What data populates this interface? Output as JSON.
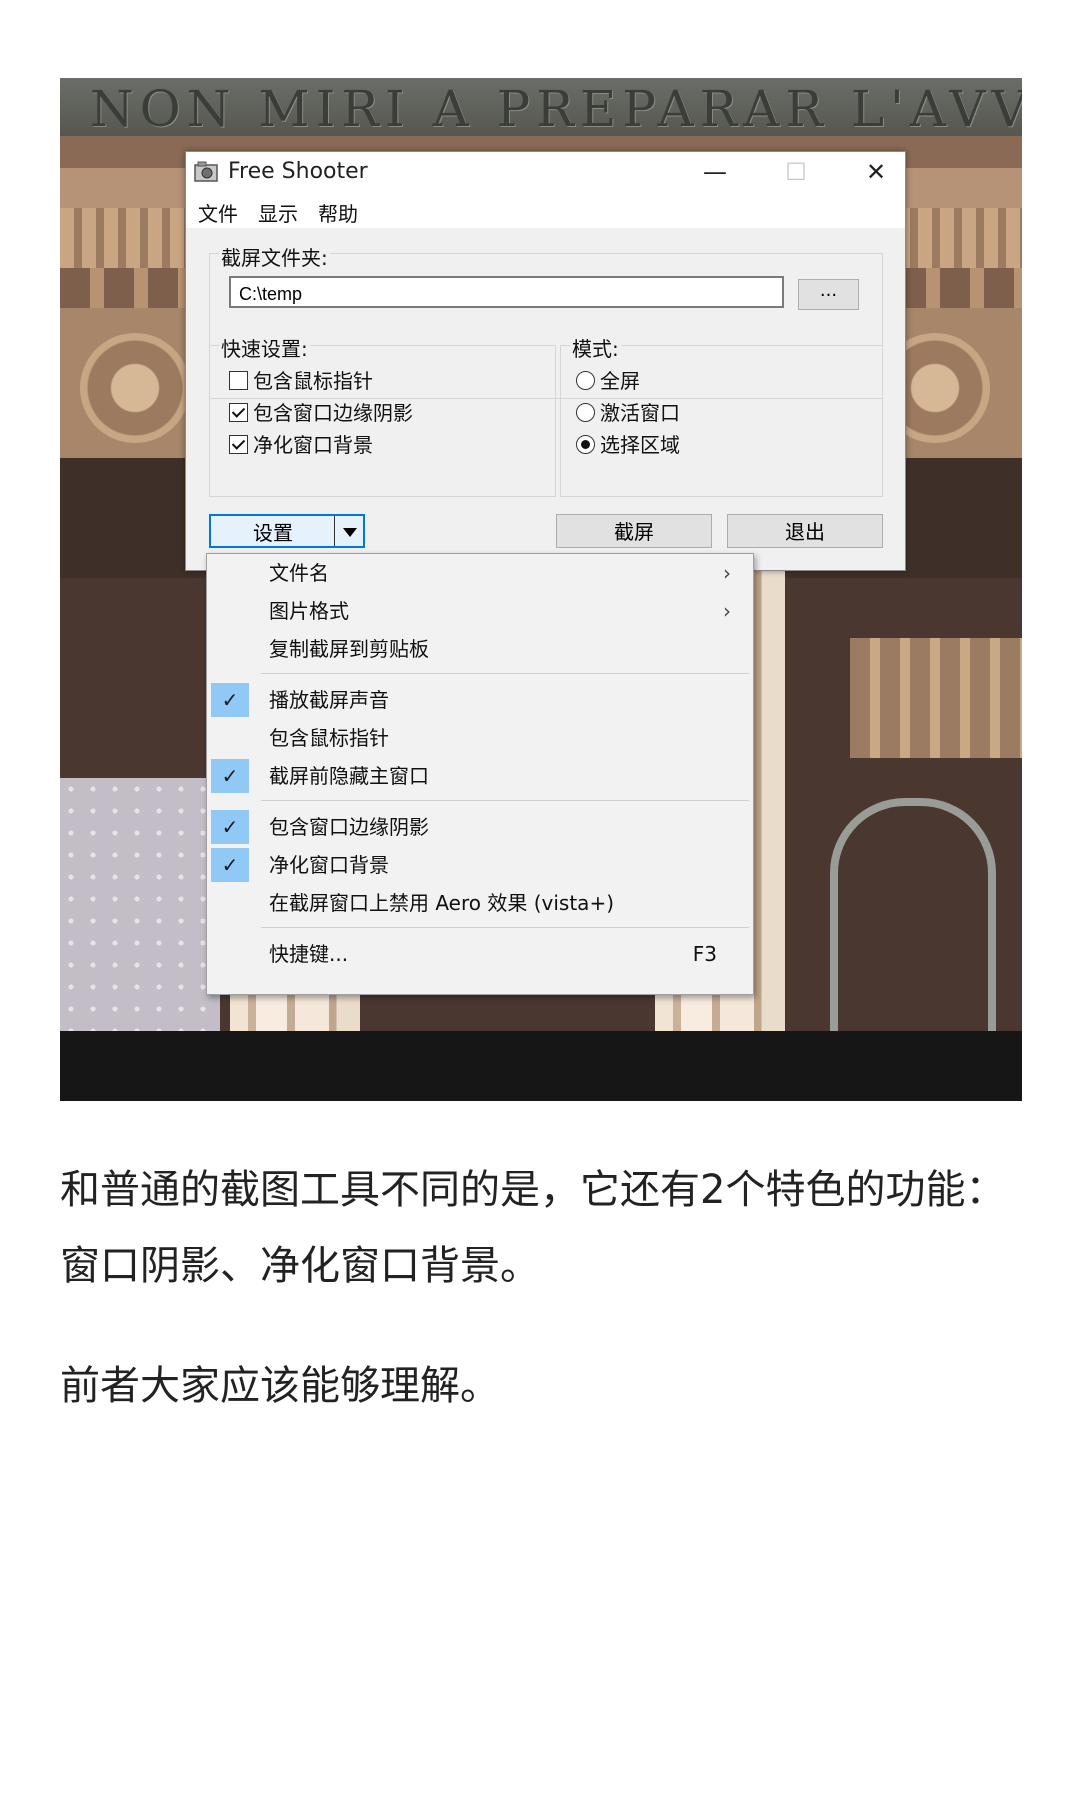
{
  "background_inscription": "NON MIRI A PREPARAR L'AVVEN",
  "window": {
    "title": "Free Shooter",
    "minimize": "—",
    "maximize": "☐",
    "close": "✕",
    "menu": [
      "文件",
      "显示",
      "帮助"
    ]
  },
  "folder_group": {
    "label": "截屏文件夹:",
    "path_value": "C:\\temp",
    "browse_label": "..."
  },
  "quick_settings": {
    "label": "快速设置:",
    "options": [
      {
        "label": "包含鼠标指针",
        "checked": false
      },
      {
        "label": "包含窗口边缘阴影",
        "checked": true
      },
      {
        "label": "净化窗口背景",
        "checked": true
      }
    ]
  },
  "mode": {
    "label": "模式:",
    "options": [
      {
        "label": "全屏",
        "selected": false
      },
      {
        "label": "激活窗口",
        "selected": false
      },
      {
        "label": "选择区域",
        "selected": true
      }
    ]
  },
  "buttons": {
    "settings": "设置",
    "capture": "截屏",
    "exit": "退出"
  },
  "dropdown": {
    "items": [
      {
        "label": "文件名",
        "checked": false,
        "submenu": true
      },
      {
        "label": "图片格式",
        "checked": false,
        "submenu": true
      },
      {
        "label": "复制截屏到剪贴板",
        "checked": false
      },
      {
        "label": "播放截屏声音",
        "checked": true
      },
      {
        "label": "包含鼠标指针",
        "checked": false
      },
      {
        "label": "截屏前隐藏主窗口",
        "checked": true
      },
      {
        "label": "包含窗口边缘阴影",
        "checked": true
      },
      {
        "label": "净化窗口背景",
        "checked": true
      },
      {
        "label": "在截屏窗口上禁用 Aero 效果 (vista+)",
        "checked": false
      },
      {
        "label": "快捷键...",
        "checked": false,
        "shortcut": "F3"
      }
    ],
    "check_glyph": "✓",
    "chevron_glyph": "›"
  },
  "article": {
    "para1": "和普通的截图工具不同的是，它还有2个特色的功能：窗口阴影、净化窗口背景。",
    "para2": "前者大家应该能够理解。"
  },
  "colors": {
    "check_highlight": "#90c8f6",
    "focus_border": "#0078d7"
  }
}
